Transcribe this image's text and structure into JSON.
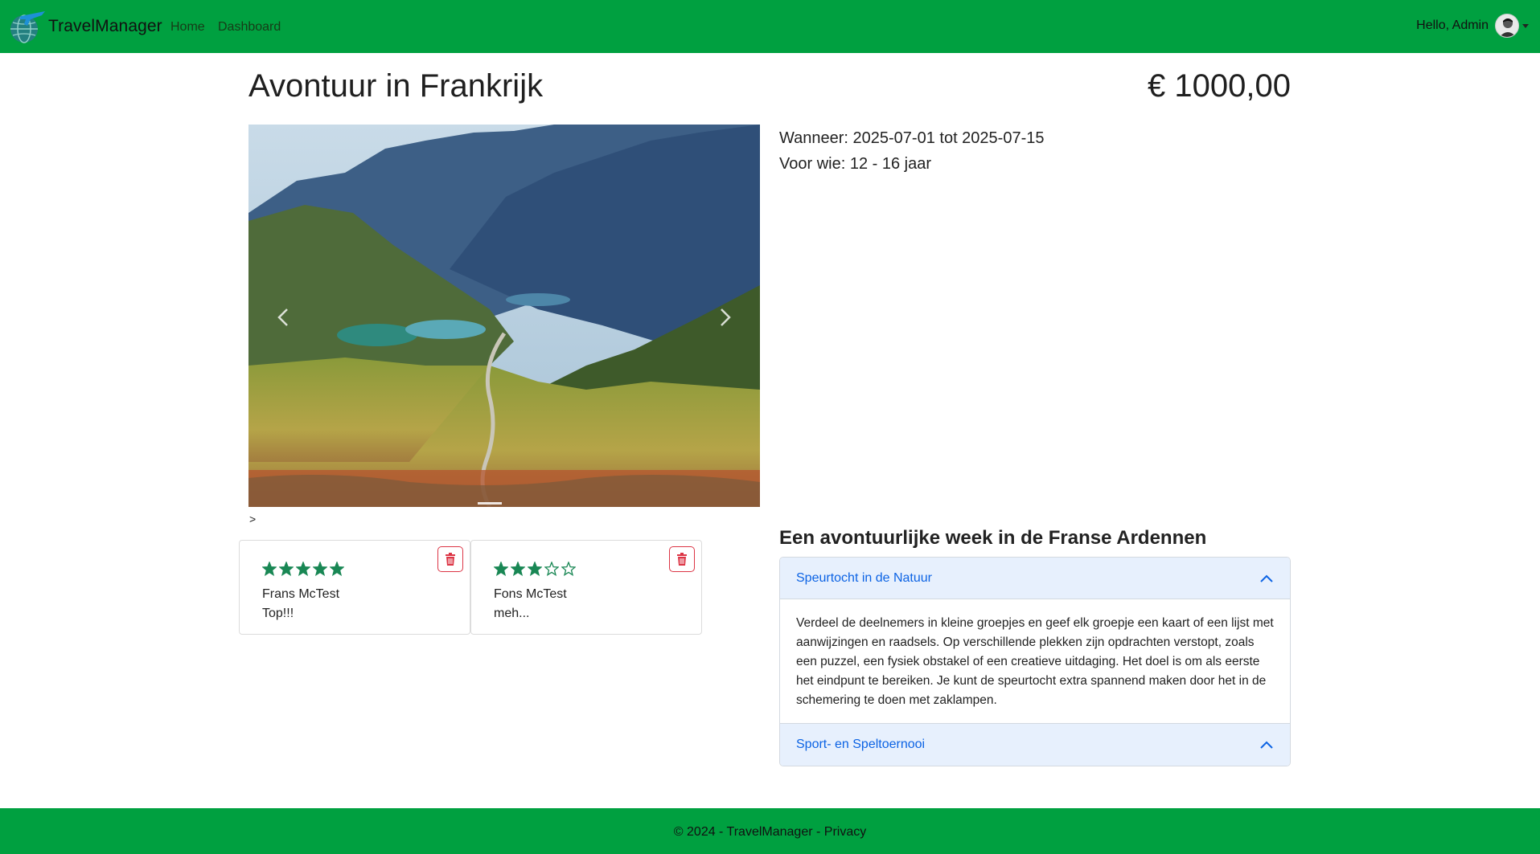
{
  "nav": {
    "brand": "TravelManager",
    "links": [
      "Home",
      "Dashboard"
    ],
    "greeting": "Hello, Admin"
  },
  "trip": {
    "title": "Avontuur in Frankrijk",
    "price": "€ 1000,00",
    "when": "Wanneer: 2025-07-01 tot 2025-07-15",
    "for_whom": "Voor wie: 12 - 16 jaar"
  },
  "carousel": {
    "stray_text": ">"
  },
  "reviews": [
    {
      "name": "Frans McTest",
      "text": "Top!!!",
      "rating": 5,
      "max": 5
    },
    {
      "name": "Fons McTest",
      "text": "meh...",
      "rating": 3,
      "max": 5
    }
  ],
  "activities": {
    "heading": "Een avontuurlijke week in de Franse Ardennen",
    "items": [
      {
        "title": "Speurtocht in de Natuur",
        "body": "Verdeel de deelnemers in kleine groepjes en geef elk groepje een kaart of een lijst met aanwijzingen en raadsels. Op verschillende plekken zijn opdrachten verstopt, zoals een puzzel, een fysiek obstakel of een creatieve uitdaging. Het doel is om als eerste het eindpunt te bereiken. Je kunt de speurtocht extra spannend maken door het in de schemering te doen met zaklampen."
      },
      {
        "title": "Sport- en Speltoernooi",
        "body": ""
      }
    ]
  },
  "footer": {
    "copyright": "© 2024 - TravelManager - ",
    "privacy": "Privacy"
  },
  "colors": {
    "navbar": "#00a040",
    "accent_blue": "#0c63e4",
    "accordion_header": "#e7f0fd",
    "star": "#198754",
    "danger": "#dc3545"
  }
}
